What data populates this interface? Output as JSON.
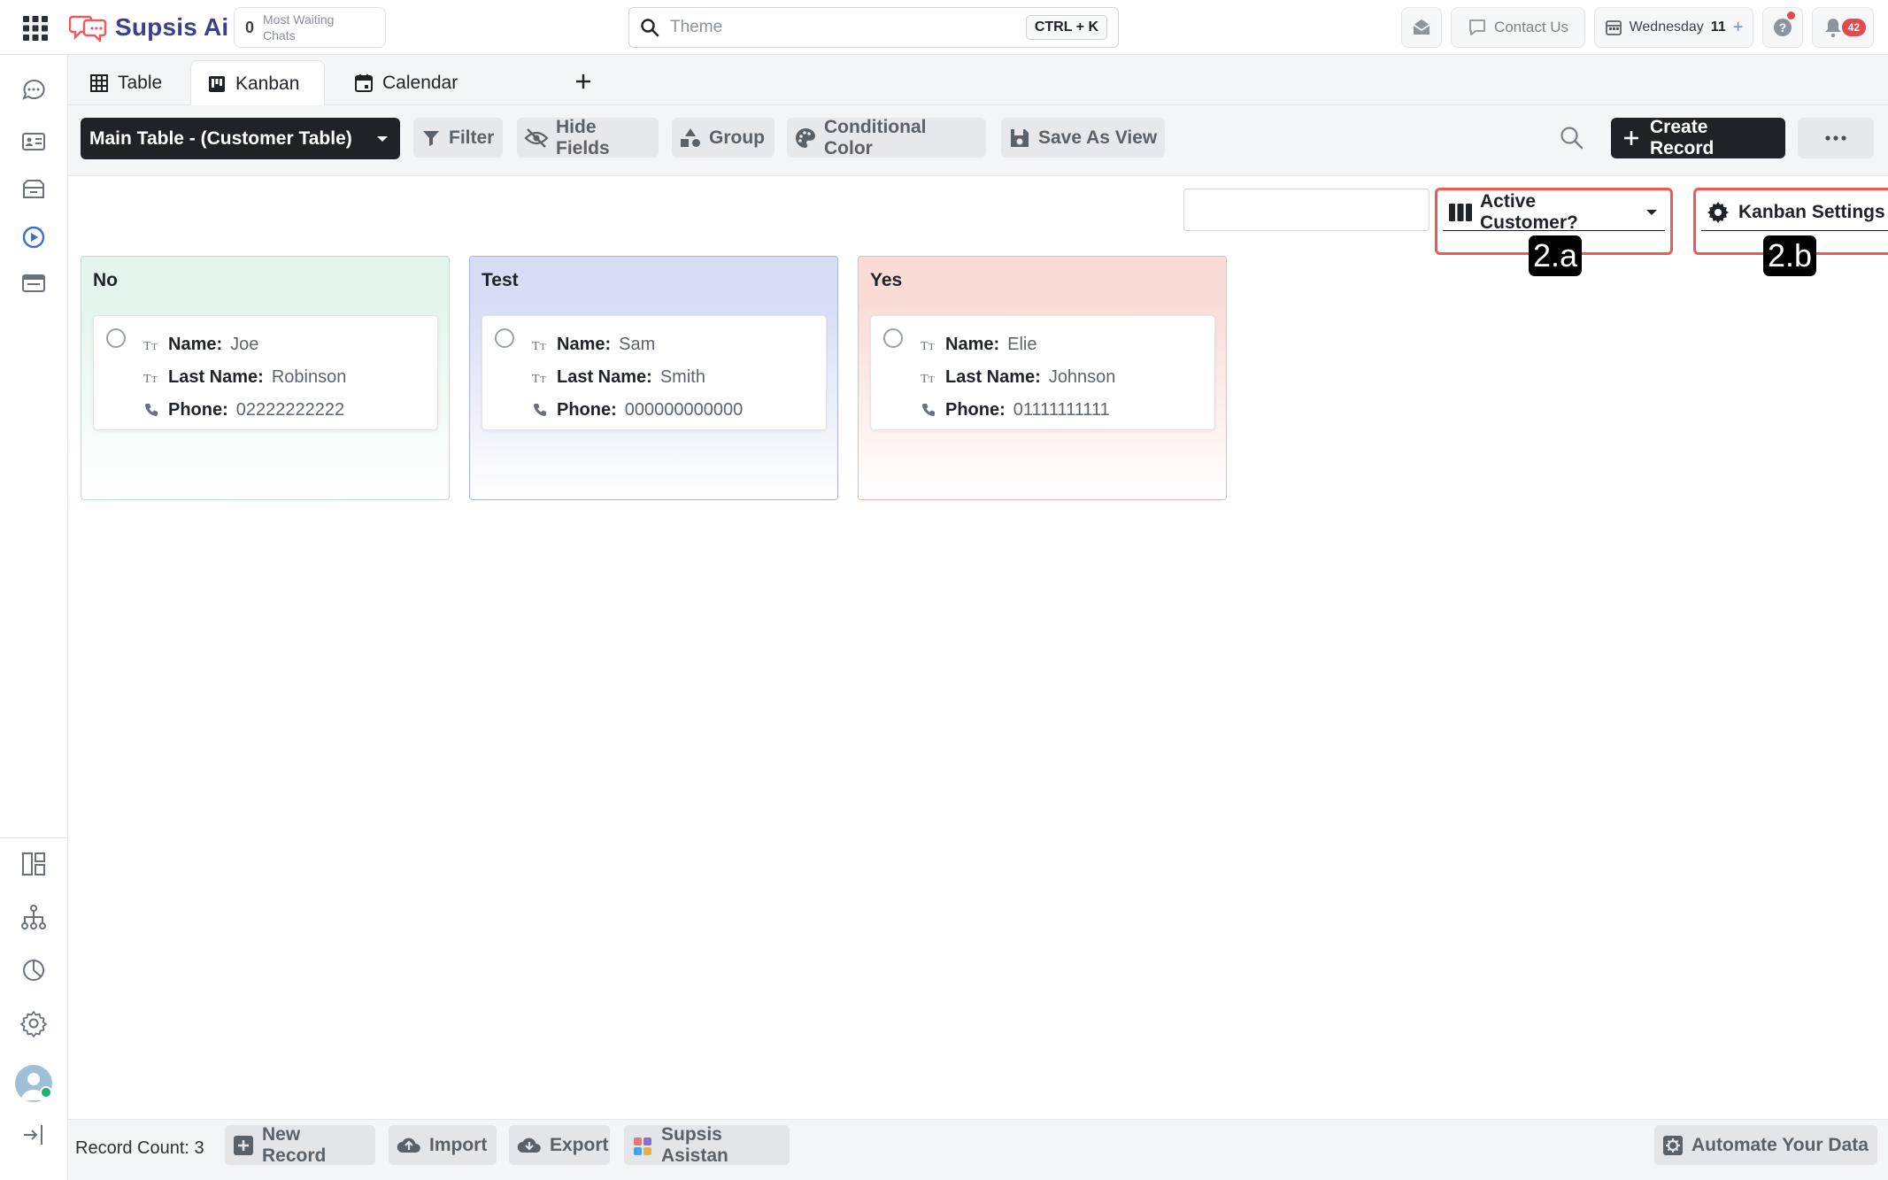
{
  "topbar": {
    "brand": "Supsis Ai",
    "waiting_count": "0",
    "waiting_label": "Most Waiting Chats",
    "search_placeholder": "Theme",
    "search_shortcut": "CTRL + K",
    "contact_label": "Contact Us",
    "date_day": "Wednesday",
    "date_num": "11",
    "notification_count": "42"
  },
  "tabs": [
    {
      "label": "Table",
      "icon": "table-icon"
    },
    {
      "label": "Kanban",
      "icon": "kanban-icon",
      "active": true
    },
    {
      "label": "Calendar",
      "icon": "calendar-icon"
    }
  ],
  "toolbar": {
    "main_table": "Main Table - (Customer Table)",
    "filter": "Filter",
    "hide_fields": "Hide Fields",
    "group": "Group",
    "conditional_color": "Conditional Color",
    "save_as_view": "Save As View",
    "create_record": "Create Record"
  },
  "kanban": {
    "group_field": "Active Customer?",
    "settings_label": "Kanban Settings",
    "marker_a": "2.a",
    "marker_b": "2.b",
    "columns": [
      {
        "title": "No",
        "bg": "#e3f5ec",
        "border": "#b9e3cb",
        "card": {
          "name_label": "Name:",
          "name": "Joe",
          "last_label": "Last Name:",
          "last": "Robinson",
          "phone_label": "Phone:",
          "phone": "02222222222"
        }
      },
      {
        "title": "Test",
        "bg": "#d7ddf5",
        "border": "#aab5e6",
        "card": {
          "name_label": "Name:",
          "name": "Sam",
          "last_label": "Last Name:",
          "last": "Smith",
          "phone_label": "Phone:",
          "phone": "000000000000"
        }
      },
      {
        "title": "Yes",
        "bg": "#fadcd6",
        "border": "#f1b7aa",
        "card": {
          "name_label": "Name:",
          "name": "Elie",
          "last_label": "Last Name:",
          "last": "Johnson",
          "phone_label": "Phone:",
          "phone": "01111111111"
        }
      }
    ]
  },
  "bottombar": {
    "record_count": "Record Count: 3",
    "new_record": "New Record",
    "import": "Import",
    "export": "Export",
    "assistant": "Supsis Asistan",
    "automate": "Automate Your Data"
  },
  "colors": {
    "accent_dark": "#1f2226",
    "highlight_red": "#ee5a52",
    "brand": "#3a3f8f"
  }
}
